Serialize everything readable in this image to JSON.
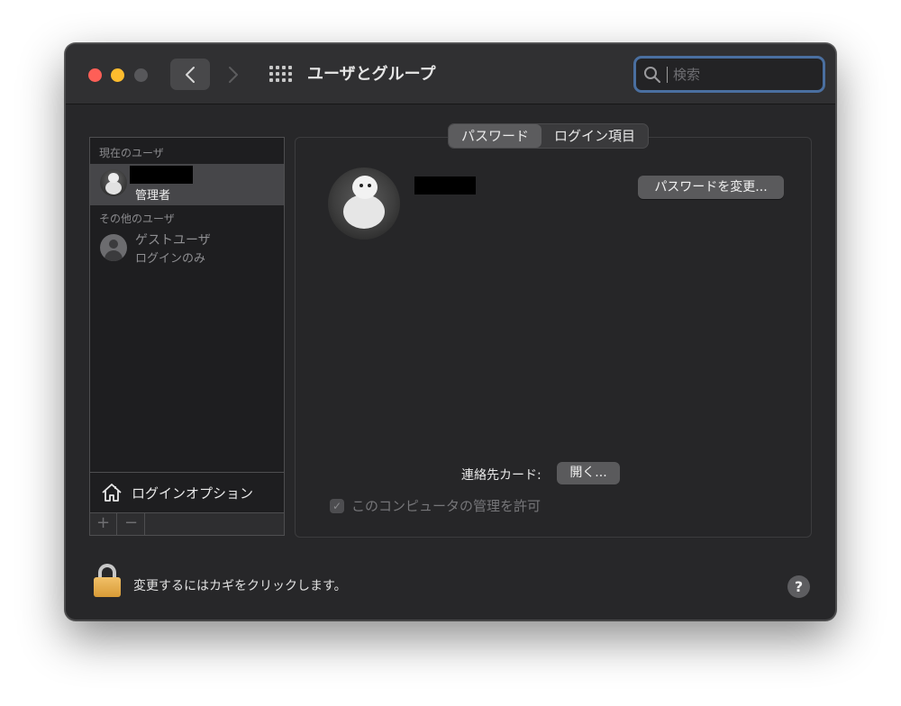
{
  "window": {
    "title": "ユーザとグループ"
  },
  "search": {
    "placeholder": "検索",
    "value": ""
  },
  "sidebar": {
    "current_users_label": "現在のユーザ",
    "current_user": {
      "role": "管理者"
    },
    "other_users_label": "その他のユーザ",
    "guest": {
      "name": "ゲストユーザ",
      "subtitle": "ログインのみ"
    },
    "login_options_label": "ログインオプション",
    "add_label": "+",
    "remove_label": "−"
  },
  "tabs": [
    {
      "label": "パスワード",
      "active": true
    },
    {
      "label": "ログイン項目",
      "active": false
    }
  ],
  "main": {
    "change_password_label": "パスワードを変更...",
    "contact_card_label": "連絡先カード:",
    "open_label": "開く...",
    "allow_admin_label": "このコンピュータの管理を許可",
    "allow_admin_checked": true
  },
  "footer": {
    "lock_text": "変更するにはカギをクリックします。",
    "help_label": "?"
  }
}
